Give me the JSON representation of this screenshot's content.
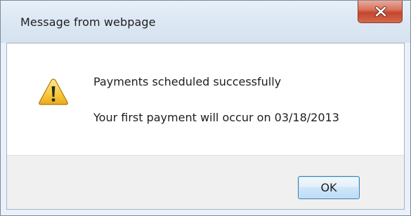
{
  "dialog": {
    "title": "Message from webpage",
    "close_icon": "close-icon",
    "warning_icon": "warning-icon",
    "message_line1": "Payments scheduled successfully",
    "message_line2": "Your first payment will occur on 03/18/2013",
    "ok_label": "OK"
  },
  "colors": {
    "close_button": "#c5452e",
    "ok_button_border": "#3c7fb1",
    "warning_fill": "#f7c93a"
  }
}
